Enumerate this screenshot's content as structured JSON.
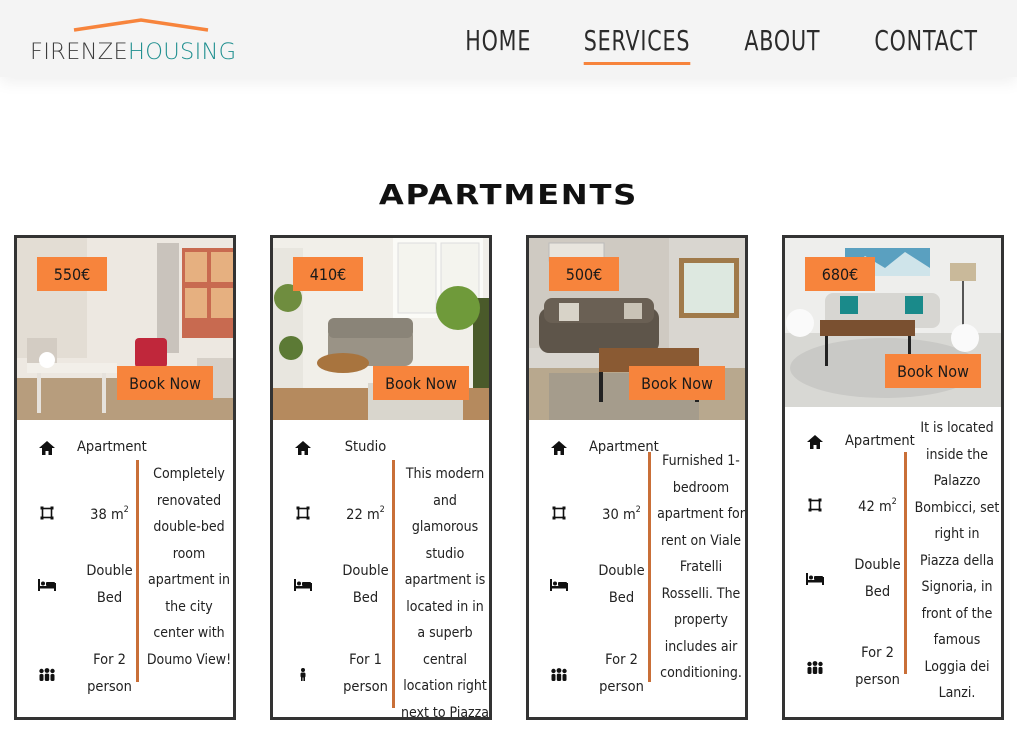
{
  "brand": {
    "part1": "FIRENZE",
    "part2": "HOUSING",
    "accent": "#f7843c",
    "teal": "#1f8f8f"
  },
  "nav": [
    {
      "label": "HOME",
      "active": false
    },
    {
      "label": "SERVICES",
      "active": true
    },
    {
      "label": "ABOUT",
      "active": false
    },
    {
      "label": "CONTACT",
      "active": false
    }
  ],
  "section_title": "APARTMENTS",
  "apartments": [
    {
      "price": "550€",
      "book_label": "Book Now",
      "type": "Apartment",
      "area": "38",
      "area_unit": "m",
      "area_exp": "2",
      "bed": "Double Bed",
      "guests": "For 2 person",
      "guests_icon": "group-icon",
      "description": "Completely renovated double-bed room apartment in the city center with Doumo View!"
    },
    {
      "price": "410€",
      "book_label": "Book Now",
      "type": "Studio",
      "area": "22",
      "area_unit": "m",
      "area_exp": "2",
      "bed": "Double Bed",
      "guests": "For 1 person",
      "guests_icon": "person-icon",
      "description": "This modern and glamorous studio apartment is located in in a superb central location right next to Piazza Repubblica."
    },
    {
      "price": "500€",
      "book_label": "Book Now",
      "type": "Apartment",
      "area": "30",
      "area_unit": "m",
      "area_exp": "2",
      "bed": "Double Bed",
      "guests": "For 2 person",
      "guests_icon": "group-icon",
      "description": "Furnished 1-bedroom apartment for rent on Viale Fratelli Rosselli. The property includes air conditioning."
    },
    {
      "price": "680€",
      "book_label": "Book Now",
      "type": "Apartment",
      "area": "42",
      "area_unit": "m",
      "area_exp": "2",
      "bed": "Double Bed",
      "guests": "For 2 person",
      "guests_icon": "group-icon",
      "description": "It is located inside the Palazzo Bombicci, set right in Piazza della Signoria, in front of the famous Loggia dei Lanzi."
    }
  ]
}
